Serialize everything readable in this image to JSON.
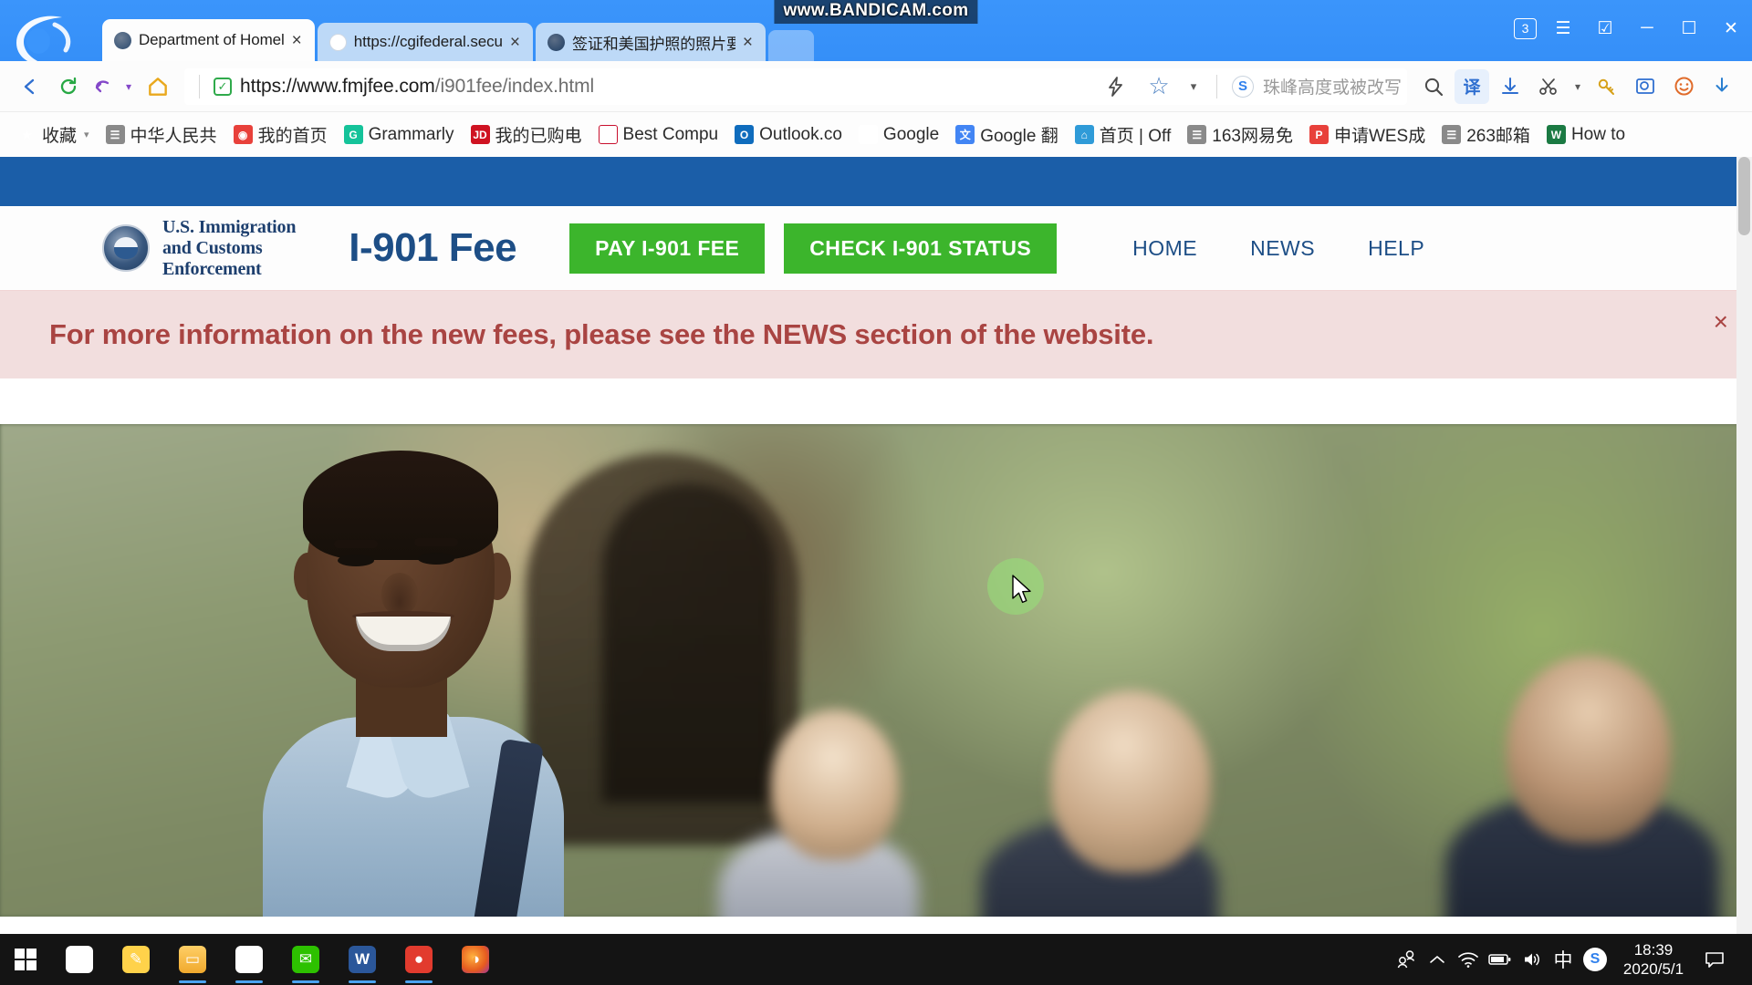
{
  "watermark": {
    "prefix": "www.",
    "brand": "BANDICAM",
    "suffix": ".com"
  },
  "browser": {
    "tabs": [
      {
        "title": "Department of Homel",
        "favicon": "dhs-seal-icon",
        "close": "×",
        "active": true
      },
      {
        "title": "https://cgifederal.secu",
        "favicon": "sogou-icon",
        "close": "×",
        "active": false
      },
      {
        "title": "签证和美国护照的照片要",
        "favicon": "visa-site-icon",
        "close": "×",
        "active": false
      }
    ],
    "window_controls": {
      "tab_count": "3",
      "menu": "☰",
      "collections": "☑",
      "minimize": "─",
      "maximize": "☐",
      "close": "✕"
    },
    "toolbar": {
      "back": "←",
      "refresh": "↻",
      "history_back": "↩",
      "history_caret": "▾",
      "home": "⌂",
      "security_badge": "✓",
      "url_protocol": "https://",
      "url_host": "www.fmjfee.com",
      "url_path": "/i901fee/index.html",
      "lightning": "⚡",
      "favorite_star": "☆",
      "favorite_caret": "▾",
      "omni_hint": "珠峰高度或被改写",
      "search": "🔍",
      "translate": "译",
      "save_page": "⤓",
      "scissors": "✂",
      "scissors_caret": "▾",
      "key": "🔑",
      "magnify": "🔎",
      "smiley": "☺",
      "download": "⤓"
    },
    "bookmarks": [
      {
        "label": "收藏",
        "icon": "star-icon",
        "caret": "▾"
      },
      {
        "label": "中华人民共",
        "icon": "document-icon"
      },
      {
        "label": "我的首页",
        "icon": "weibo-icon"
      },
      {
        "label": "Grammarly",
        "icon": "grammarly-icon"
      },
      {
        "label": "我的已购电",
        "icon": "jd-icon"
      },
      {
        "label": "Best Compu",
        "icon": "usnews-icon"
      },
      {
        "label": "Outlook.co",
        "icon": "outlook-icon"
      },
      {
        "label": "Google",
        "icon": "google-icon"
      },
      {
        "label": "Google 翻",
        "icon": "google-translate-icon"
      },
      {
        "label": "首页 | Off",
        "icon": "homepage-icon"
      },
      {
        "label": "163网易免",
        "icon": "document-icon"
      },
      {
        "label": "申请WES成",
        "icon": "p-icon"
      },
      {
        "label": "263邮箱",
        "icon": "document-icon"
      },
      {
        "label": "How to",
        "icon": "word-icon"
      }
    ]
  },
  "site": {
    "agency_lines": [
      "U.S. Immigration",
      "and Customs",
      "Enforcement"
    ],
    "title": "I-901 Fee",
    "buttons": [
      {
        "label": "PAY I-901 FEE",
        "color": "#3cb52c"
      },
      {
        "label": "CHECK I-901 STATUS",
        "color": "#3cb52c"
      }
    ],
    "nav": [
      "HOME",
      "NEWS",
      "HELP"
    ],
    "alert": {
      "message": "For more information on the new fees, please see the NEWS section of the website.",
      "close": "×",
      "background": "#f2dede",
      "text_color": "#a94442"
    }
  },
  "taskbar": {
    "start": "windows-logo",
    "apps": [
      {
        "name": "sogou-browser",
        "glyph": "S",
        "running": false
      },
      {
        "name": "sticky-notes",
        "glyph": "✎",
        "running": false
      },
      {
        "name": "file-explorer",
        "glyph": "🗀",
        "running": true
      },
      {
        "name": "sogou-browser-active",
        "glyph": "S",
        "running": true
      },
      {
        "name": "wechat",
        "glyph": "💬",
        "running": true
      },
      {
        "name": "word",
        "glyph": "W",
        "running": true
      },
      {
        "name": "screen-recorder",
        "glyph": "●",
        "running": true
      },
      {
        "name": "firefox",
        "glyph": "🦊",
        "running": false
      }
    ],
    "tray": [
      {
        "name": "people-icon",
        "glyph": "👥"
      },
      {
        "name": "show-hidden-icons",
        "glyph": "⌃"
      },
      {
        "name": "wifi-icon",
        "glyph": "◔"
      },
      {
        "name": "battery-icon",
        "glyph": "▬"
      },
      {
        "name": "volume-icon",
        "glyph": "🔊"
      },
      {
        "name": "ime-chinese",
        "glyph": "中"
      },
      {
        "name": "sogou-input",
        "glyph": "S"
      }
    ],
    "clock": {
      "time": "18:39",
      "date": "2020/5/1"
    },
    "action_center": "💬"
  }
}
